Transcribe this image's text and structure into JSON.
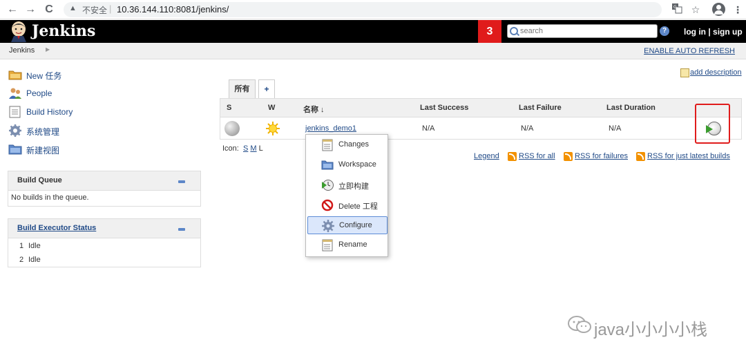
{
  "browser": {
    "back": "←",
    "forward": "→",
    "reload": "C",
    "insecure_label": "不安全",
    "url": "10.36.144.110:8081/jenkins/"
  },
  "header": {
    "logo_text": "Jenkins",
    "build_count": "3",
    "search_placeholder": "search",
    "help": "?",
    "login": "log in | sign up"
  },
  "breadcrumb": {
    "root": "Jenkins",
    "arrow": "▶",
    "auto_refresh": "ENABLE AUTO REFRESH"
  },
  "sidebar": {
    "tasks": [
      {
        "label": "New 任务",
        "icon": "folder-icon"
      },
      {
        "label": "People",
        "icon": "people-icon"
      },
      {
        "label": "Build History",
        "icon": "notepad-icon"
      },
      {
        "label": "系统管理",
        "icon": "gear-icon"
      },
      {
        "label": "新建视图",
        "icon": "folder-icon"
      }
    ],
    "build_queue": {
      "title": "Build Queue",
      "empty": "No builds in the queue."
    },
    "executors": {
      "title": "Build Executor Status",
      "rows": [
        {
          "num": "1",
          "status": "Idle"
        },
        {
          "num": "2",
          "status": "Idle"
        }
      ]
    }
  },
  "main": {
    "add_description": "add description",
    "tabs": [
      {
        "label": "所有",
        "active": true
      },
      {
        "label": "+",
        "active": false
      }
    ],
    "table": {
      "headers": {
        "s": "S",
        "w": "W",
        "name": "名称 ↓",
        "last_success": "Last Success",
        "last_failure": "Last Failure",
        "last_duration": "Last Duration"
      },
      "rows": [
        {
          "name": "jenkins_demo1",
          "last_success": "N/A",
          "last_failure": "N/A",
          "last_duration": "N/A"
        }
      ]
    },
    "icon_size": {
      "label": "Icon:",
      "s": "S",
      "m": "M",
      "l": "L"
    },
    "links": {
      "legend": "Legend",
      "rss_all": "RSS for all",
      "rss_failures": "RSS for failures",
      "rss_latest": "RSS for just latest builds"
    }
  },
  "context_menu": {
    "items": [
      {
        "label": "Changes",
        "icon": "notepad-icon",
        "active": false
      },
      {
        "label": "Workspace",
        "icon": "folder-icon",
        "active": false
      },
      {
        "label": "立即构建",
        "icon": "clock-play-icon",
        "active": false
      },
      {
        "label": "Delete 工程",
        "icon": "no-entry-icon",
        "active": false
      },
      {
        "label": "Configure",
        "icon": "gear-icon",
        "active": true
      },
      {
        "label": "Rename",
        "icon": "notepad-icon",
        "active": false
      }
    ]
  },
  "watermark": {
    "text": "java小小小小栈"
  },
  "colors": {
    "link": "#204a87",
    "header_bg": "#000000",
    "badge": "#e01b1b",
    "highlight": "#e01b1b"
  }
}
